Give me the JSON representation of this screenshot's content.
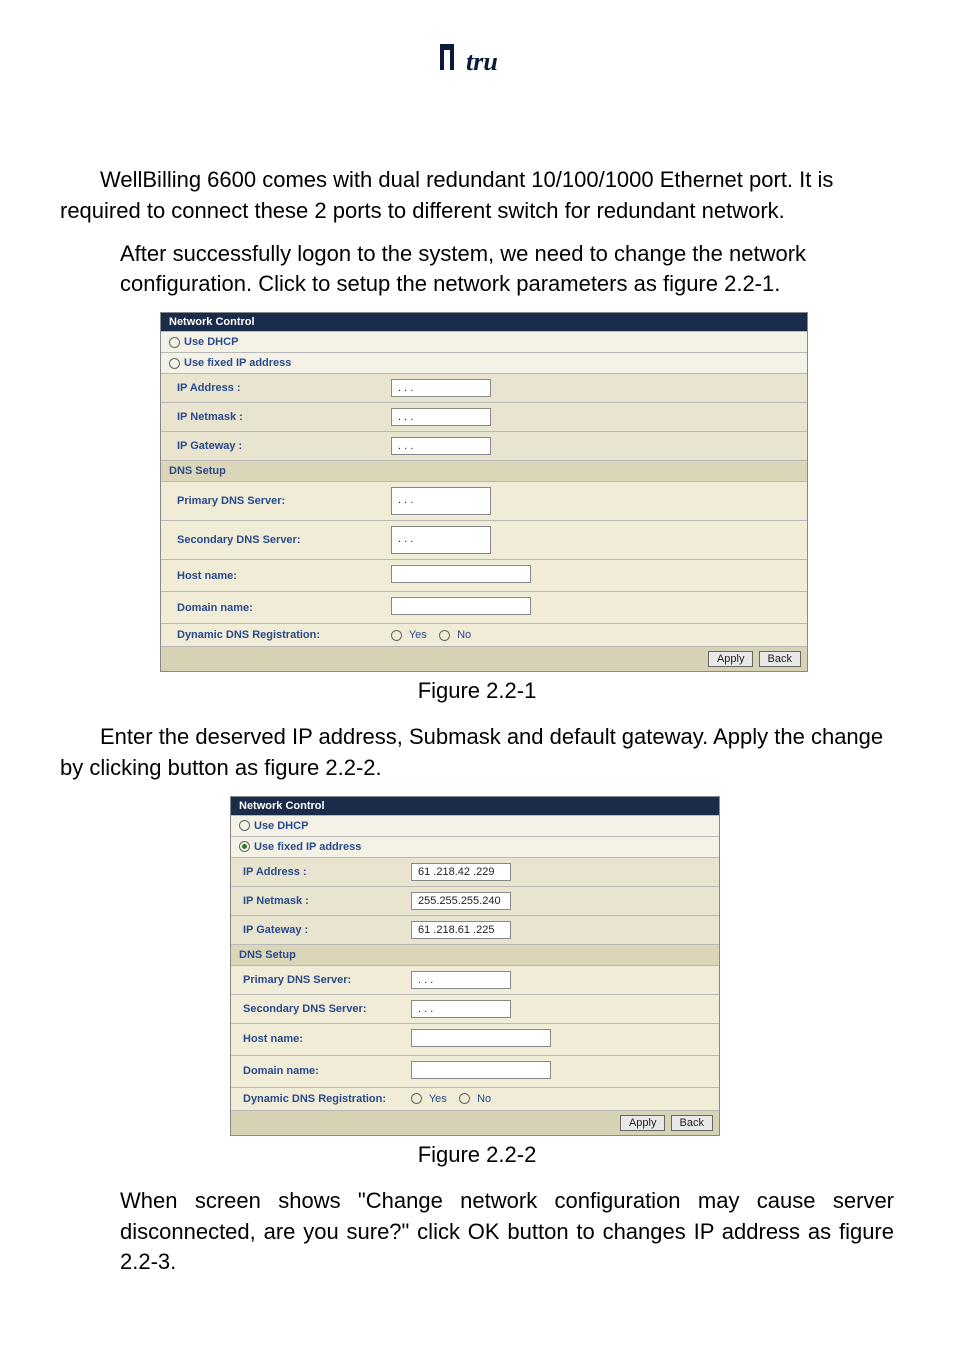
{
  "logo": {
    "text": "tru"
  },
  "para1": "WellBilling 6600 comes with dual redundant 10/100/1000 Ethernet port. It is required to connect these 2 ports to different switch for redundant network.",
  "para2_part1": "After successfully logon to the system, we need to change the network configuration. Click",
  "para2_link": "",
  "para2_part2": " to setup the network parameters as figure 2.2-1.",
  "figure1": {
    "header": "Network Control",
    "radio_dhcp": "Use DHCP",
    "radio_fixed": "Use fixed IP address",
    "ip_address_label": "IP Address :",
    "ip_address_value": ".   .   .",
    "ip_netmask_label": "IP Netmask :",
    "ip_netmask_value": ".   .   .",
    "ip_gateway_label": "IP Gateway :",
    "ip_gateway_value": ".   .   .",
    "dns_setup": "DNS Setup",
    "primary_dns_label": "Primary DNS Server:",
    "primary_dns_value": ".   .   .",
    "secondary_dns_label": "Secondary DNS Server:",
    "secondary_dns_value": ".   .   .",
    "host_name_label": "Host name:",
    "domain_name_label": "Domain name:",
    "dyn_dns_label": "Dynamic DNS Registration:",
    "yes": "Yes",
    "no": "No",
    "apply": "Apply",
    "back": "Back",
    "caption": "Figure 2.2-1"
  },
  "para3_part1": "Enter the deserved IP address, Submask and default gateway. Apply the change by clicking ",
  "para3_link": "",
  "para3_part2": " button as figure 2.2-2.",
  "figure2": {
    "header": "Network Control",
    "radio_dhcp": "Use DHCP",
    "radio_fixed": "Use fixed IP address",
    "ip_address_label": "IP Address :",
    "ip_address_value": "61 .218.42 .229",
    "ip_netmask_label": "IP Netmask :",
    "ip_netmask_value": "255.255.255.240",
    "ip_gateway_label": "IP Gateway :",
    "ip_gateway_value": "61 .218.61 .225",
    "dns_setup": "DNS Setup",
    "primary_dns_label": "Primary DNS Server:",
    "primary_dns_value": ".   .   .",
    "secondary_dns_label": "Secondary DNS Server:",
    "secondary_dns_value": ".   .   .",
    "host_name_label": "Host name:",
    "domain_name_label": "Domain name:",
    "dyn_dns_label": "Dynamic DNS Registration:",
    "yes": "Yes",
    "no": "No",
    "apply": "Apply",
    "back": "Back",
    "caption": "Figure 2.2-2"
  },
  "para4": "When screen shows \"Change network configuration may cause server disconnected, are you sure?\" click OK button to changes IP address as figure 2.2-3."
}
